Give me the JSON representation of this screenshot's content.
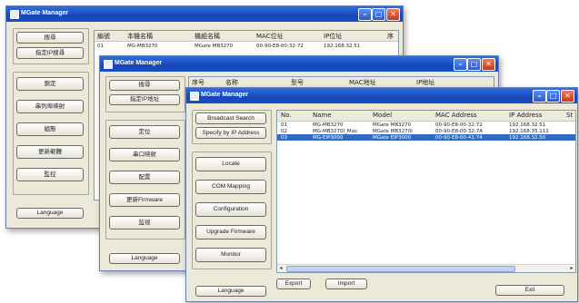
{
  "app_title": "MGate Manager",
  "windows": {
    "w1": {
      "buttons": [
        "搜尋",
        "指定IP搜尋",
        "鎖定",
        "串列埠映射",
        "組態",
        "更新韌體",
        "監控",
        "Language"
      ],
      "columns": [
        "編號",
        "本機名稱",
        "機組名稱",
        "MAC位址",
        "IP位址",
        "序"
      ],
      "rows": [
        [
          "01",
          "MG-MB3270",
          "MGate MB3270",
          "00-90-E8-00-32-72",
          "192.168.32.51"
        ]
      ]
    },
    "w2": {
      "buttons": [
        "搜尋",
        "指定IP地址",
        "定位",
        "串口映射",
        "配置",
        "更新Firmware",
        "监视",
        "Language"
      ],
      "columns": [
        "序号",
        "名称",
        "型号",
        "MAC地址",
        "IP地址"
      ]
    },
    "w3": {
      "buttons": [
        "Broadcast Search",
        "Specify by IP Address",
        "Locate",
        "COM Mapping",
        "Configuration",
        "Upgrade Firmware",
        "Monitor",
        "Language"
      ],
      "bottom_buttons": [
        "Export",
        "Import",
        "Exit"
      ],
      "columns": [
        "No.",
        "Name",
        "Model",
        "MAC Address",
        "IP Address",
        "St"
      ],
      "rows": [
        [
          "01",
          "MG-MB3270",
          "MGate MB3270",
          "00-90-E8-00-32:72",
          "192.168.32.51"
        ],
        [
          "02",
          "MG-MB3270I_Mas",
          "MGate MB3270I",
          "00-90-E8-00-32:7A",
          "192.168.35.111"
        ],
        [
          "03",
          "MG-EIP3000",
          "MGate EIP3000",
          "00-90-E8-00-41:74",
          "192.168.32.50"
        ]
      ],
      "selected_row": 3
    }
  },
  "colors": {
    "title_blue": "#1546b8",
    "selection_blue": "#316ac5",
    "close_red": "#c8381c"
  }
}
